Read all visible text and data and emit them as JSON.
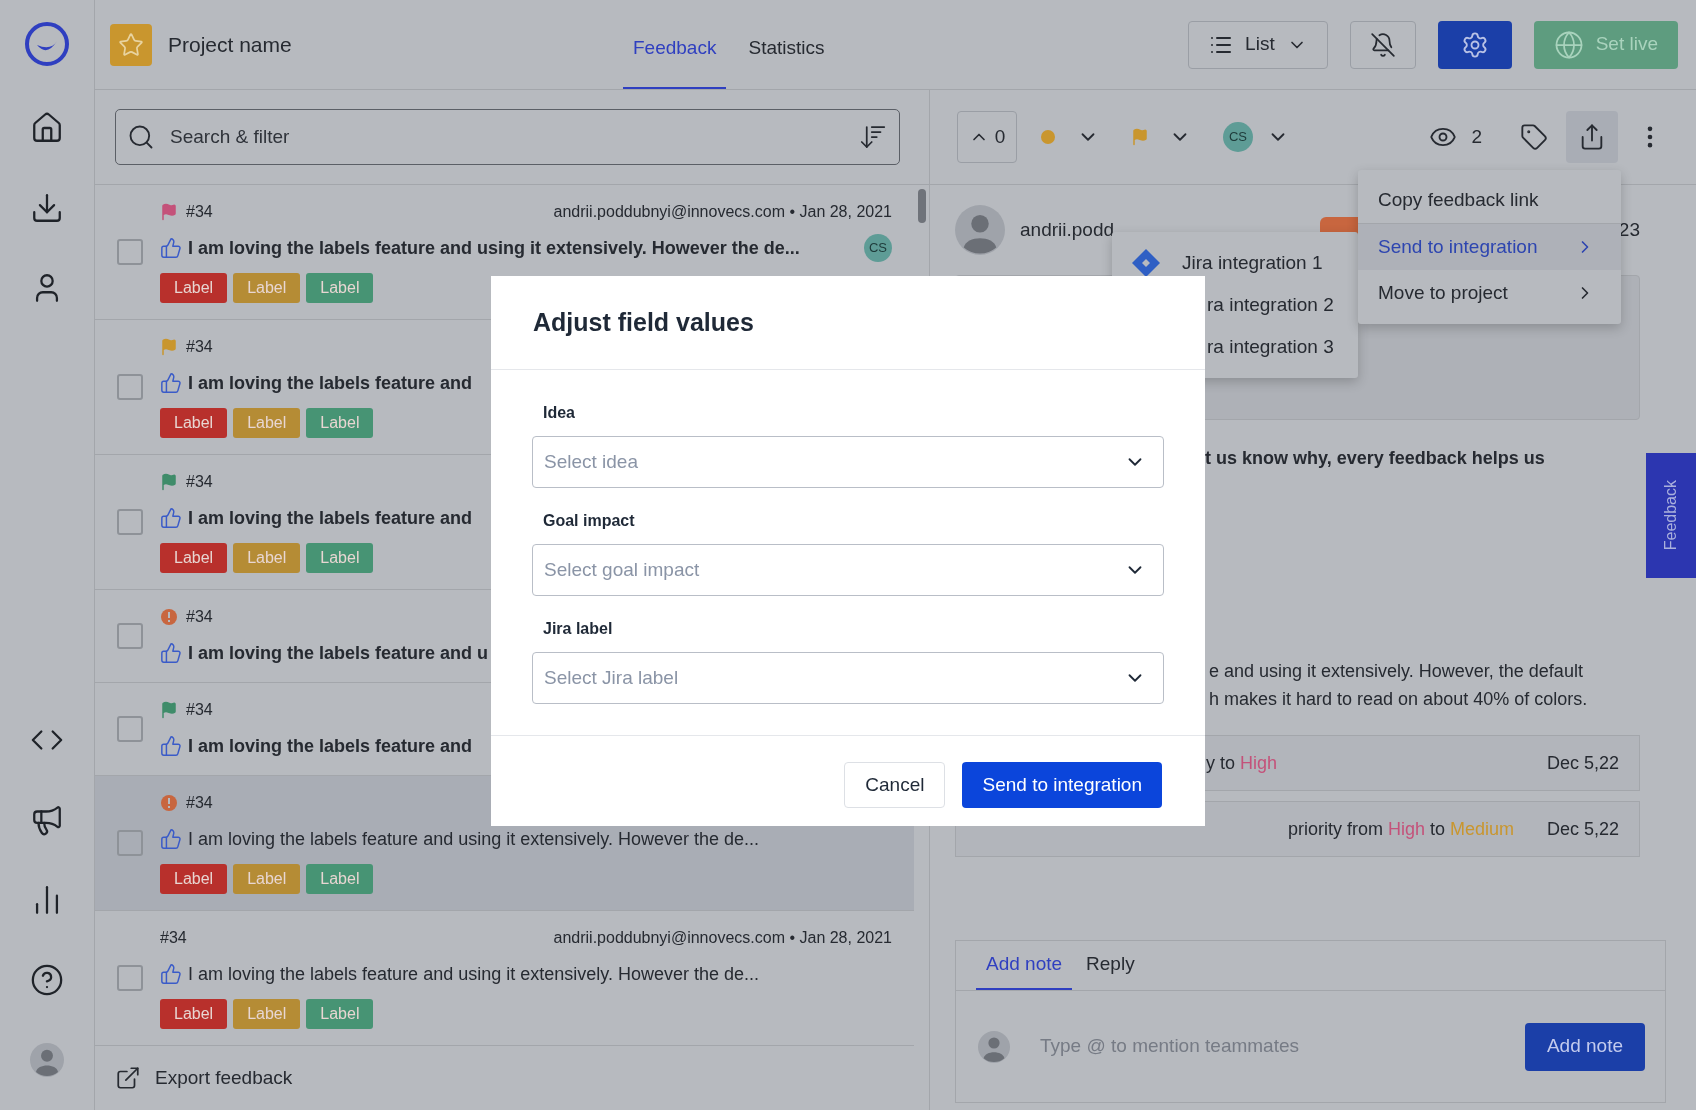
{
  "header": {
    "project_name": "Project name",
    "tabs": [
      {
        "label": "Feedback",
        "selected": true
      },
      {
        "label": "Statistics",
        "selected": false
      }
    ],
    "view_button": "List",
    "publish_button": "Set live"
  },
  "search": {
    "placeholder": "Search & filter"
  },
  "feedback_list": [
    {
      "number": "#34",
      "marker": {
        "kind": "flag",
        "color": "#c4527a"
      },
      "meta": "andrii.poddubnyi@innovecs.com • Jan 28, 2021",
      "text": "I am loving the labels feature and using it extensively. However the de...",
      "assignee": "CS",
      "unread": true,
      "checked": false,
      "selected": false,
      "labels": [
        {
          "text": "Label",
          "color": "#b8302c"
        },
        {
          "text": "Label",
          "color": "#b58c35"
        },
        {
          "text": "Label",
          "color": "#479474"
        }
      ]
    },
    {
      "number": "#34",
      "marker": {
        "kind": "flag",
        "color": "#c9962e"
      },
      "text": "I am loving the labels feature and",
      "unread": true,
      "checked": false,
      "selected": false,
      "labels": [
        {
          "text": "Label",
          "color": "#b8302c"
        },
        {
          "text": "Label",
          "color": "#b58c35"
        },
        {
          "text": "Label",
          "color": "#479474"
        }
      ]
    },
    {
      "number": "#34",
      "marker": {
        "kind": "flag",
        "color": "#3f8c6a"
      },
      "text": "I am loving the labels feature and",
      "unread": true,
      "checked": false,
      "selected": false,
      "labels": [
        {
          "text": "Label",
          "color": "#b8302c"
        },
        {
          "text": "Label",
          "color": "#b58c35"
        },
        {
          "text": "Label",
          "color": "#479474"
        }
      ]
    },
    {
      "number": "#34",
      "marker": {
        "kind": "alert",
        "color": "#c8663f"
      },
      "text": "I am loving the labels feature and u",
      "unread": true,
      "checked": false,
      "selected": false
    },
    {
      "number": "#34",
      "marker": {
        "kind": "flag",
        "color": "#3f8c6a"
      },
      "text": "I am loving the labels feature and",
      "unread": true,
      "checked": false,
      "selected": false
    },
    {
      "number": "#34",
      "marker": {
        "kind": "alert",
        "color": "#c8663f"
      },
      "text": "I am loving the labels feature and using it extensively. However the de...",
      "unread": false,
      "checked": false,
      "selected": true,
      "labels": [
        {
          "text": "Label",
          "color": "#b8302c"
        },
        {
          "text": "Label",
          "color": "#b58c35"
        },
        {
          "text": "Label",
          "color": "#479474"
        }
      ]
    },
    {
      "number": "#34",
      "meta": "andrii.poddubnyi@innovecs.com • Jan 28, 2021",
      "text": "I am loving the labels feature and using it extensively. However the de...",
      "unread": false,
      "checked": false,
      "selected": false,
      "labels": [
        {
          "text": "Label",
          "color": "#b8302c"
        },
        {
          "text": "Label",
          "color": "#b58c35"
        },
        {
          "text": "Label",
          "color": "#479474"
        }
      ]
    }
  ],
  "export": "Export feedback",
  "detail": {
    "toolbar": {
      "upvotes": "0",
      "assignee": "CS",
      "viewers": "2"
    },
    "author": "andrii.podd",
    "date": "23",
    "question": "t us know why, every feedback helps us",
    "body": [
      "e and using it extensively.  However, the default",
      "h makes it hard to read on about 40% of colors."
    ],
    "activity": [
      {
        "segments": [
          {
            "text": "y to ",
            "kind": "plain"
          },
          {
            "text": "High",
            "kind": "high"
          }
        ],
        "date": "Dec 5,22"
      },
      {
        "segments": [
          {
            "text": "priority from ",
            "kind": "plain"
          },
          {
            "text": "High",
            "kind": "high"
          },
          {
            "text": " to ",
            "kind": "plain"
          },
          {
            "text": "Medium",
            "kind": "medium"
          }
        ],
        "date": "Dec 5,22"
      }
    ],
    "composer": {
      "tabs": [
        {
          "label": "Add note",
          "selected": true
        },
        {
          "label": "Reply",
          "selected": false
        }
      ],
      "placeholder": "Type @ to mention teammates",
      "button": "Add note"
    }
  },
  "share_menu": {
    "items": [
      {
        "label": "Copy feedback link",
        "submenu": false,
        "selected": false
      },
      {
        "label": "Send to integration",
        "submenu": true,
        "selected": true
      },
      {
        "label": "Move to project",
        "submenu": true,
        "selected": false
      }
    ]
  },
  "integration_menu": {
    "items": [
      {
        "label": "Jira integration 1",
        "kind": "jira"
      },
      {
        "label": "ra integration 2",
        "kind": "partial"
      },
      {
        "label": "ra integration 3",
        "kind": "partial"
      }
    ]
  },
  "modal": {
    "title": "Adjust field values",
    "fields": [
      {
        "label": "Idea",
        "placeholder": "Select idea"
      },
      {
        "label": "Goal impact",
        "placeholder": "Select goal impact"
      },
      {
        "label": "Jira label",
        "placeholder": "Select Jira label"
      }
    ],
    "buttons": [
      {
        "label": "Cancel",
        "kind": "secondary"
      },
      {
        "label": "Send to integration",
        "kind": "primary"
      }
    ]
  },
  "feedback_tab": "Feedback"
}
